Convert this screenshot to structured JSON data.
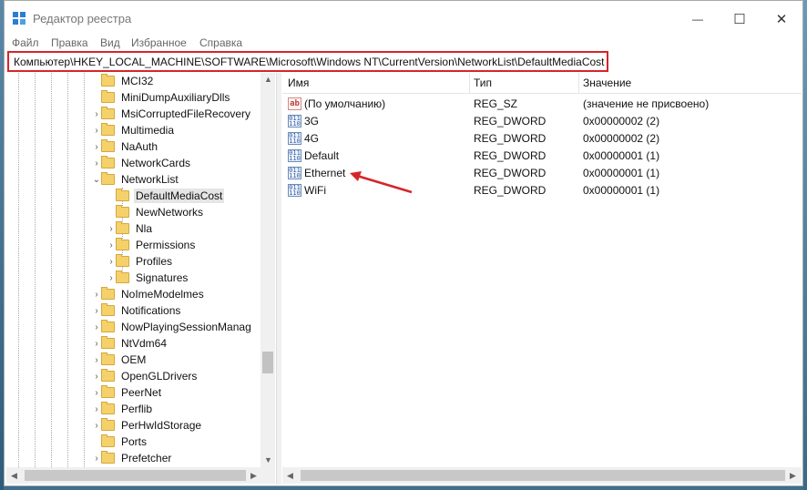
{
  "window": {
    "title": "Редактор реестра",
    "minimize_icon": "—",
    "maximize_icon": "☐",
    "close_icon": "✕"
  },
  "menu": [
    "Файл",
    "Правка",
    "Вид",
    "Избранное",
    "Справка"
  ],
  "address": "Компьютер\\HKEY_LOCAL_MACHINE\\SOFTWARE\\Microsoft\\Windows NT\\CurrentVersion\\NetworkList\\DefaultMediaCost",
  "tree": {
    "items": [
      {
        "label": "MCI32",
        "expander": ""
      },
      {
        "label": "MiniDumpAuxiliaryDlls",
        "expander": ""
      },
      {
        "label": "MsiCorruptedFileRecovery",
        "expander": "›"
      },
      {
        "label": "Multimedia",
        "expander": "›"
      },
      {
        "label": "NaAuth",
        "expander": "›"
      },
      {
        "label": "NetworkCards",
        "expander": "›"
      },
      {
        "label": "NetworkList",
        "expander": "⌄"
      },
      {
        "label": "DefaultMediaCost",
        "expander": "",
        "selected": true
      },
      {
        "label": "NewNetworks",
        "expander": ""
      },
      {
        "label": "Nla",
        "expander": "›"
      },
      {
        "label": "Permissions",
        "expander": "›"
      },
      {
        "label": "Profiles",
        "expander": "›"
      },
      {
        "label": "Signatures",
        "expander": "›"
      },
      {
        "label": "NoImeModelmes",
        "expander": "›"
      },
      {
        "label": "Notifications",
        "expander": "›"
      },
      {
        "label": "NowPlayingSessionManag",
        "expander": "›"
      },
      {
        "label": "NtVdm64",
        "expander": "›"
      },
      {
        "label": "OEM",
        "expander": "›"
      },
      {
        "label": "OpenGLDrivers",
        "expander": "›"
      },
      {
        "label": "PeerNet",
        "expander": "›"
      },
      {
        "label": "Perflib",
        "expander": "›"
      },
      {
        "label": "PerHwIdStorage",
        "expander": "›"
      },
      {
        "label": "Ports",
        "expander": ""
      },
      {
        "label": "Prefetcher",
        "expander": "›"
      }
    ]
  },
  "list": {
    "headers": {
      "name": "Имя",
      "type": "Тип",
      "value": "Значение"
    },
    "rows": [
      {
        "icon": "ab",
        "name": "(По умолчанию)",
        "type": "REG_SZ",
        "value": "(значение не присвоено)"
      },
      {
        "icon": "011 110",
        "name": "3G",
        "type": "REG_DWORD",
        "value": "0x00000002 (2)"
      },
      {
        "icon": "011 110",
        "name": "4G",
        "type": "REG_DWORD",
        "value": "0x00000002 (2)"
      },
      {
        "icon": "011 110",
        "name": "Default",
        "type": "REG_DWORD",
        "value": "0x00000001 (1)"
      },
      {
        "icon": "011 110",
        "name": "Ethernet",
        "type": "REG_DWORD",
        "value": "0x00000001 (1)"
      },
      {
        "icon": "011 110",
        "name": "WiFi",
        "type": "REG_DWORD",
        "value": "0x00000001 (1)"
      }
    ]
  },
  "colors": {
    "annotation_red": "#d4262a"
  }
}
